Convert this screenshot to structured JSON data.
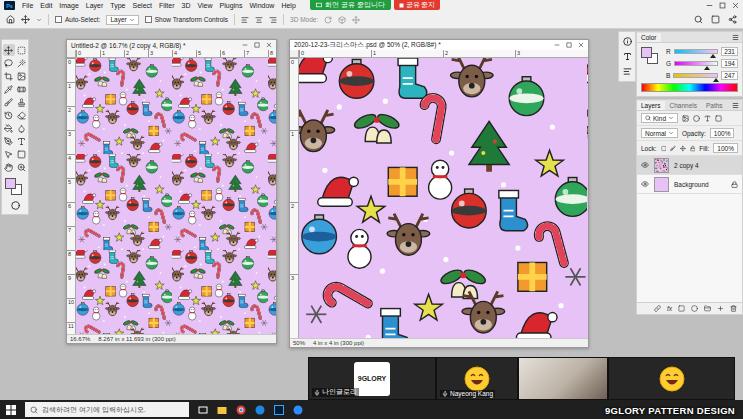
{
  "app": {
    "logo": "Ps"
  },
  "menu": [
    "File",
    "Edit",
    "Image",
    "Layer",
    "Type",
    "Select",
    "Filter",
    "3D",
    "View",
    "Plugins",
    "Window",
    "Help"
  ],
  "share_banner": {
    "status": "화면 공유 중입니다",
    "stop": "공유 중지"
  },
  "options_bar": {
    "auto_select": {
      "label": "Auto-Select:",
      "checked": false
    },
    "target": "Layer",
    "show_transform": {
      "label": "Show Transform Controls",
      "checked": false
    },
    "mode_3d": "3D Mode:"
  },
  "toolbar": {
    "tools": [
      {
        "kind": "move",
        "selected": true
      },
      {
        "kind": "marquee",
        "selected": false
      },
      {
        "kind": "lasso",
        "selected": false
      },
      {
        "kind": "wand",
        "selected": false
      },
      {
        "kind": "crop",
        "selected": false
      },
      {
        "kind": "frame",
        "selected": false
      },
      {
        "kind": "eyedropper",
        "selected": false
      },
      {
        "kind": "heal",
        "selected": false
      },
      {
        "kind": "brush",
        "selected": false
      },
      {
        "kind": "stamp",
        "selected": false
      },
      {
        "kind": "history",
        "selected": false
      },
      {
        "kind": "eraser",
        "selected": false
      },
      {
        "kind": "bucket",
        "selected": false
      },
      {
        "kind": "blur",
        "selected": false
      },
      {
        "kind": "pen",
        "selected": false
      },
      {
        "kind": "type",
        "selected": false
      },
      {
        "kind": "select",
        "selected": false
      },
      {
        "kind": "shape",
        "selected": false
      },
      {
        "kind": "hand",
        "selected": false
      },
      {
        "kind": "zoom",
        "selected": false
      }
    ]
  },
  "documents": [
    {
      "title": "Untitled-2 @ 16.7% (2 copy 4, RGB/8) *",
      "active": false,
      "zoom": "16.67%",
      "doc_size": "8.267 in x 11.693 in (300 ppi)",
      "ruler_top": [
        "0",
        "1",
        "2",
        "3",
        "4",
        "5",
        "6",
        "7",
        "8"
      ],
      "ruler_left": [
        "0",
        "1",
        "2",
        "3",
        "4",
        "5",
        "6",
        "7",
        "8",
        "9",
        "10",
        "11"
      ]
    },
    {
      "title": "2020-12-23-크리스마스.psd @ 50% (2, RGB/8#) *",
      "active": true,
      "zoom": "50%",
      "doc_size": "4 in x 4 in (300 ppi)",
      "ruler_top": [
        "0",
        "1",
        "2",
        "3"
      ],
      "ruler_left": [
        "0",
        "1",
        "2",
        "3"
      ]
    }
  ],
  "color_panel": {
    "title": "Color",
    "channels": [
      {
        "name": "R",
        "value": "231",
        "level": 0.906
      },
      {
        "name": "G",
        "value": "194",
        "level": 0.761
      },
      {
        "name": "B",
        "value": "247",
        "level": 0.969
      }
    ]
  },
  "layers_panel": {
    "tabs": [
      {
        "label": "Layers",
        "selected": true
      },
      {
        "label": "Channels",
        "selected": false
      },
      {
        "label": "Paths",
        "selected": false
      }
    ],
    "filter": "Kind",
    "blend": "Normal",
    "opacity_label": "Opacity:",
    "opacity": "100%",
    "lock_label": "Lock:",
    "fill_label": "Fill:",
    "fill": "100%",
    "layers": [
      {
        "name": "2 copy 4",
        "selected": true,
        "visible": true,
        "locked": false,
        "kind": "pattern"
      },
      {
        "name": "Background",
        "selected": false,
        "visible": true,
        "locked": true,
        "kind": "solid"
      }
    ],
    "footer_fx": "fx"
  },
  "video_call": {
    "participants": [
      {
        "kind": "logo",
        "logo": "9GLORY",
        "name": "나인글로리"
      },
      {
        "kind": "emoji",
        "name": "Nayeong Kang"
      },
      {
        "kind": "photo"
      },
      {
        "kind": "emoji"
      }
    ],
    "watermark": "9GLORY PATTERN DESIGN"
  },
  "taskbar": {
    "search_placeholder": "검색하려면 여기에 입력하십시오."
  }
}
